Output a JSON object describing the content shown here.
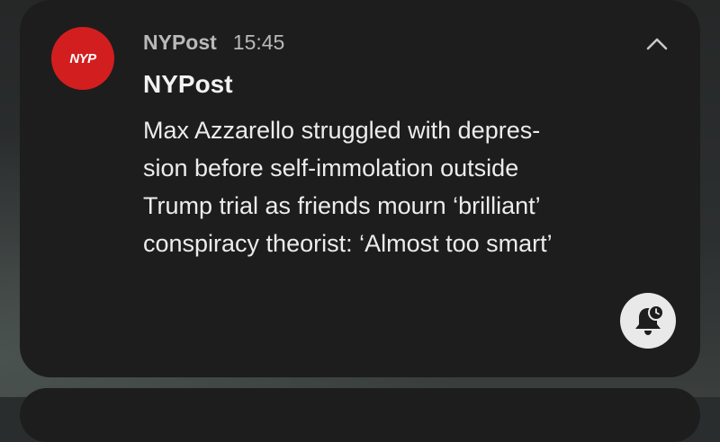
{
  "notification": {
    "app_icon": {
      "icon": "nypost-logo-icon",
      "logo_text": "NYP",
      "color": "#d21e1e"
    },
    "app_name": "NYPost",
    "time": "15:45",
    "title": "NYPost",
    "body_lines": [
      "Max Azzarello struggled with depres-",
      "sion before self-immolation outside",
      "Trump trial as friends mourn ‘brilliant’",
      "conspiracy theorist: ‘Almost too smart’"
    ],
    "collapse_icon": "chevron-up-icon",
    "snooze_icon": "bell-snooze-icon"
  },
  "colors": {
    "card_background": "#1d1d1d",
    "text_primary": "#f2f2f2",
    "text_secondary": "#b9b9b9",
    "snooze_button_bg": "#e9e9e9"
  }
}
